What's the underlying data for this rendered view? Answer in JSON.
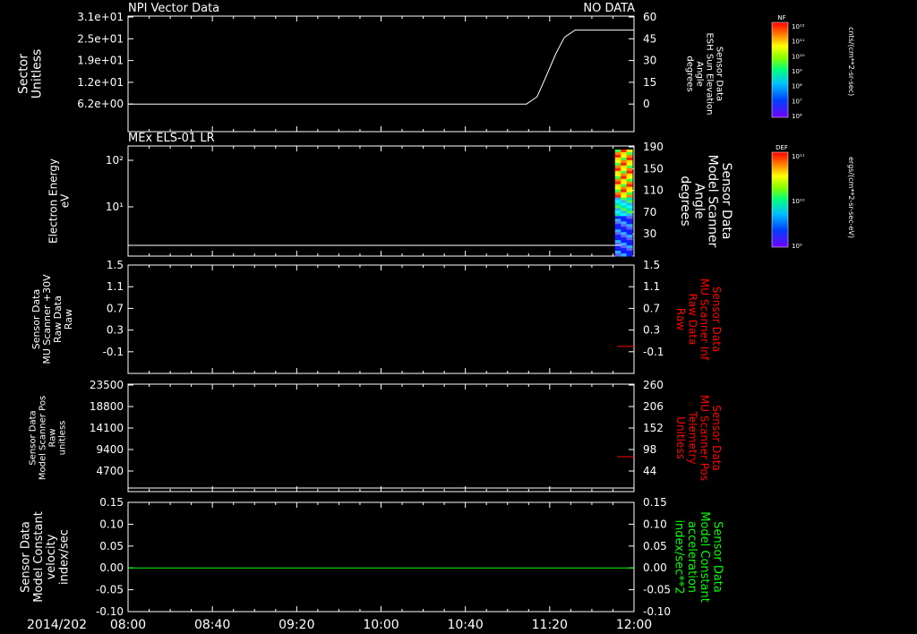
{
  "date_label": "2014/202",
  "x_ticks": [
    "08:00",
    "08:40",
    "09:20",
    "10:00",
    "10:40",
    "11:20",
    "12:00"
  ],
  "colors": {
    "white": "#ffffff",
    "red": "#ff0000",
    "green": "#00ff00"
  },
  "colorbars": [
    {
      "title": "NF",
      "units": "cnts/(cm**2-sr-sec)",
      "ticks": [
        "10¹²",
        "10¹¹",
        "10¹⁰",
        "10⁹",
        "10⁸",
        "10⁷",
        "10⁶"
      ]
    },
    {
      "title": "DEF",
      "units": "ergs/(cm**2-sr-sec-eV)",
      "ticks": [
        "10¹¹",
        "10¹⁰",
        "10⁹"
      ]
    }
  ],
  "chart_data": [
    {
      "type": "line",
      "title": "NPI Vector Data",
      "status": "NO DATA",
      "ylabel_left": [
        "Sector",
        "Unitless"
      ],
      "yticks_left": [
        "3.1e+01",
        "2.5e+01",
        "1.9e+01",
        "1.2e+01",
        "6.2e+00"
      ],
      "ylabel_right": [
        "Sensor Data",
        "ESH Sun Elevation",
        "Angle",
        "degrees"
      ],
      "yticks_right": [
        "60",
        "45",
        "30",
        "15",
        "0"
      ],
      "ylim_right": [
        -15,
        60
      ],
      "series": [
        {
          "color": "white",
          "x": [
            "08:00",
            "10:40",
            "11:09",
            "11:14",
            "11:18",
            "11:23",
            "11:27",
            "11:32",
            "12:00"
          ],
          "y": [
            0,
            0,
            0,
            5,
            18,
            35,
            46,
            51,
            51
          ]
        }
      ]
    },
    {
      "type": "heatmap",
      "title": "MEx ELS-01 LR",
      "ylabel_left": [
        "Electron Energy",
        "eV"
      ],
      "yticks_left": [
        "10²",
        "10¹"
      ],
      "ylabel_right": [
        "Sensor Data",
        "Model Scanner",
        "Angle",
        "degrees"
      ],
      "yticks_right": [
        "190",
        "150",
        "110",
        "70",
        "30"
      ],
      "ylim_right": [
        0,
        190
      ],
      "heat_time": [
        "11:51",
        "12:00"
      ],
      "heat_colors": [
        "#1020ff",
        "#6060ff",
        "#30b0ff",
        "#00e0c0",
        "#40ff40",
        "#ffe000",
        "#ff8000",
        "#ff2000",
        "#ffff00",
        "#00ffff"
      ],
      "series": [
        {
          "color": "white",
          "x": [
            "08:00",
            "11:54"
          ],
          "y": [
            8,
            8
          ]
        }
      ]
    },
    {
      "type": "line",
      "ylabel_left": [
        "Sensor Data",
        "MU Scanner +30V",
        "Raw Data",
        "Raw"
      ],
      "yticks_left": [
        "1.5",
        "1.1",
        "0.7",
        "0.3",
        "-0.1"
      ],
      "ylabel_right": [
        "Sensor Data",
        "MU Scanner Inf",
        "Raw Data",
        "Raw"
      ],
      "ylabel_right_color": "red",
      "yticks_right": [
        "1.5",
        "1.1",
        "0.7",
        "0.3",
        "-0.1"
      ],
      "ylim": [
        -0.5,
        1.5
      ],
      "series": [
        {
          "color": "red",
          "x": [
            "11:52",
            "12:00"
          ],
          "y": [
            0.0,
            0.0
          ]
        }
      ]
    },
    {
      "type": "line",
      "ylabel_left": [
        "Sensor Data",
        "Model Scanner Pos",
        "Raw",
        "unitless"
      ],
      "yticks_left": [
        "23500",
        "18800",
        "14100",
        "9400",
        "4700"
      ],
      "ylabel_right": [
        "Sensor Data",
        "MU Scanner Pos",
        "Telemetry",
        "Unitless"
      ],
      "ylabel_right_color": "red",
      "yticks_right": [
        "260",
        "206",
        "152",
        "98",
        "44"
      ],
      "ylim_right": [
        -10,
        260
      ],
      "series": [
        {
          "color": "red",
          "x": [
            "11:52",
            "12:00"
          ],
          "y": [
            80,
            80
          ]
        },
        {
          "color": "white",
          "x": [
            "08:00",
            "12:00"
          ],
          "y": [
            1,
            1
          ]
        }
      ]
    },
    {
      "type": "line",
      "ylabel_left": [
        "Sensor Data",
        "Model Constant",
        "velocity",
        "index/sec"
      ],
      "yticks_left": [
        "0.15",
        "0.10",
        "0.05",
        "0.00",
        "-0.05",
        "-0.10"
      ],
      "ylabel_right": [
        "Sensor Data",
        "Model Constant",
        "acceleration",
        "index/sec**2"
      ],
      "ylabel_right_color": "green",
      "yticks_right": [
        "0.15",
        "0.10",
        "0.05",
        "0.00",
        "-0.05",
        "-0.10"
      ],
      "ylim": [
        -0.1,
        0.15
      ],
      "series": [
        {
          "color": "green",
          "x": [
            "08:00",
            "12:00"
          ],
          "y": [
            0,
            0
          ]
        }
      ]
    }
  ]
}
